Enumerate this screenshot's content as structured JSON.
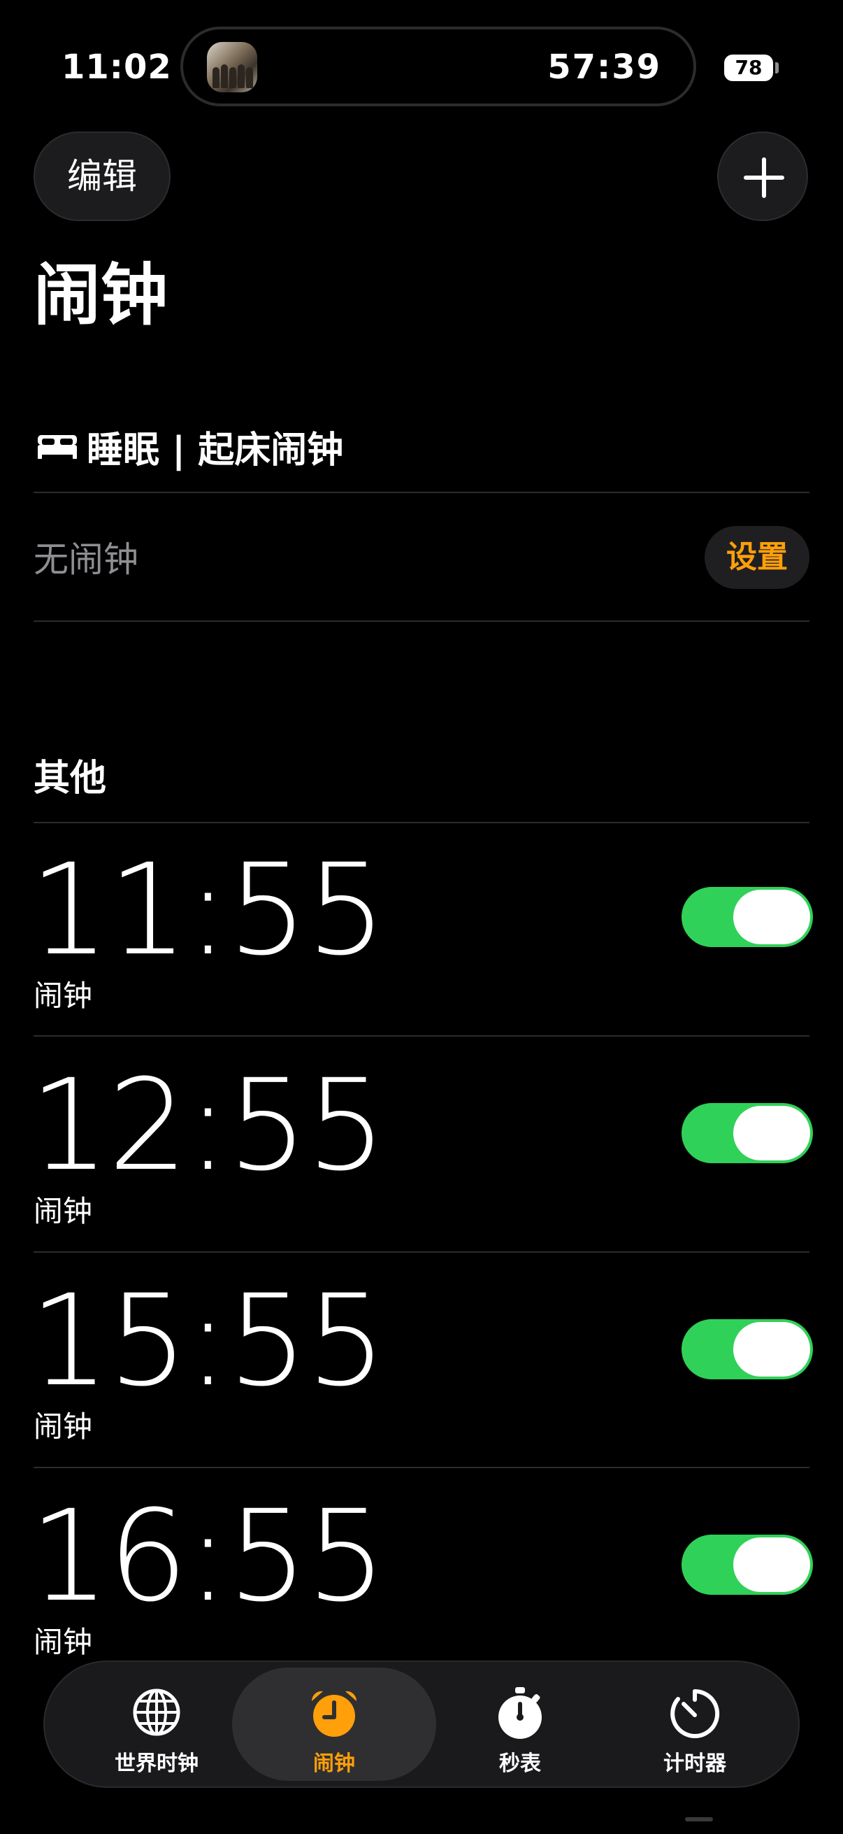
{
  "status_bar": {
    "time": "11:02",
    "live_activity_timer": "57:39",
    "battery_level": "78"
  },
  "header": {
    "edit_label": "编辑",
    "title": "闹钟"
  },
  "sleep": {
    "header": "睡眠 | 起床闹钟",
    "no_alarm": "无闹钟",
    "setup_label": "设置"
  },
  "other": {
    "header": "其他",
    "alarms": [
      {
        "time": "11:55",
        "label": "闹钟",
        "enabled": true
      },
      {
        "time": "12:55",
        "label": "闹钟",
        "enabled": true
      },
      {
        "time": "15:55",
        "label": "闹钟",
        "enabled": true
      },
      {
        "time": "16:55",
        "label": "闹钟",
        "enabled": true
      }
    ]
  },
  "tabbar": {
    "tabs": [
      {
        "label": "世界时钟",
        "icon": "globe-icon"
      },
      {
        "label": "闹钟",
        "icon": "alarm-clock-icon",
        "active": true
      },
      {
        "label": "秒表",
        "icon": "stopwatch-icon"
      },
      {
        "label": "计时器",
        "icon": "timer-icon"
      }
    ]
  },
  "colors": {
    "accent": "#ff9f0a",
    "toggle_on": "#30d158",
    "background": "#000000"
  }
}
